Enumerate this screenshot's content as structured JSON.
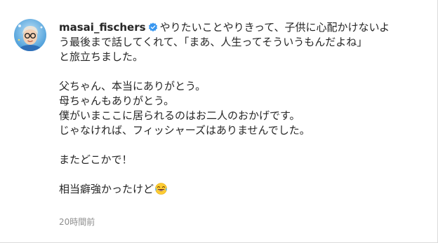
{
  "comment": {
    "avatar_icon": "user-avatar",
    "username": "masai_fischers",
    "verified_icon": "verified-badge-icon",
    "verified_color": "#3897f0",
    "lines": [
      "やりたいことやりきって、子供に心配かけないよ",
      "う最後まで話してくれて、「まあ、人生ってそういうもんだよね」",
      "と旅立ちました。",
      "",
      "父ちゃん、本当にありがとう。",
      "母ちゃんもありがとう。",
      "僕がいまここに居られるのはお二人のおかげです。",
      "じゃなければ、フィッシャーズはありませんでした。",
      "",
      "またどこかで！",
      "",
      "相当癖強かったけど"
    ],
    "trailing_emoji": "tears-of-joy-emoji",
    "timestamp": "20時間前"
  }
}
